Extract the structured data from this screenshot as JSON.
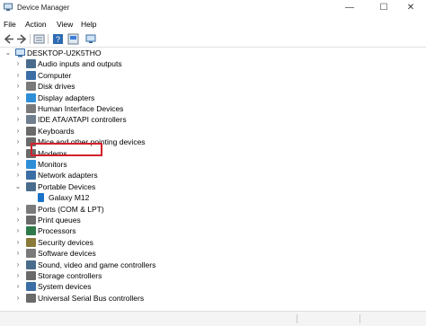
{
  "window": {
    "title": "Device Manager",
    "controls": [
      "—",
      "☐",
      "✕"
    ]
  },
  "menu": [
    "File",
    "Action",
    "View",
    "Help"
  ],
  "tree": {
    "root": "DESKTOP-U2K5THO",
    "categories": [
      {
        "label": "Audio inputs and outputs",
        "icon": "speaker-icon",
        "expanded": false
      },
      {
        "label": "Computer",
        "icon": "computer-icon",
        "expanded": false
      },
      {
        "label": "Disk drives",
        "icon": "disk-drive-icon",
        "expanded": false
      },
      {
        "label": "Display adapters",
        "icon": "display-adapter-icon",
        "expanded": false
      },
      {
        "label": "Human Interface Devices",
        "icon": "hid-icon",
        "expanded": false
      },
      {
        "label": "IDE ATA/ATAPI controllers",
        "icon": "ide-controller-icon",
        "expanded": false
      },
      {
        "label": "Keyboards",
        "icon": "keyboard-icon",
        "expanded": false
      },
      {
        "label": "Mice and other pointing devices",
        "icon": "mouse-icon",
        "expanded": false
      },
      {
        "label": "Modems",
        "icon": "modem-icon",
        "expanded": false
      },
      {
        "label": "Monitors",
        "icon": "monitor-icon",
        "expanded": false
      },
      {
        "label": "Network adapters",
        "icon": "network-adapter-icon",
        "expanded": false
      },
      {
        "label": "Portable Devices",
        "icon": "portable-device-icon",
        "expanded": true
      },
      {
        "label": "Ports (COM & LPT)",
        "icon": "port-icon",
        "expanded": false
      },
      {
        "label": "Print queues",
        "icon": "printer-icon",
        "expanded": false
      },
      {
        "label": "Processors",
        "icon": "processor-icon",
        "expanded": false
      },
      {
        "label": "Security devices",
        "icon": "security-icon",
        "expanded": false
      },
      {
        "label": "Software devices",
        "icon": "software-device-icon",
        "expanded": false
      },
      {
        "label": "Sound, video and game controllers",
        "icon": "sound-icon",
        "expanded": false
      },
      {
        "label": "Storage controllers",
        "icon": "storage-controller-icon",
        "expanded": false
      },
      {
        "label": "System devices",
        "icon": "system-device-icon",
        "expanded": false
      },
      {
        "label": "Universal Serial Bus controllers",
        "icon": "usb-icon",
        "expanded": false
      }
    ],
    "child": {
      "parent": "Portable Devices",
      "label": "Galaxy M12",
      "icon": "phone-icon",
      "highlighted": true
    }
  },
  "colors": {
    "highlight_border": "#d2202c",
    "accent": "#1a73c7"
  }
}
